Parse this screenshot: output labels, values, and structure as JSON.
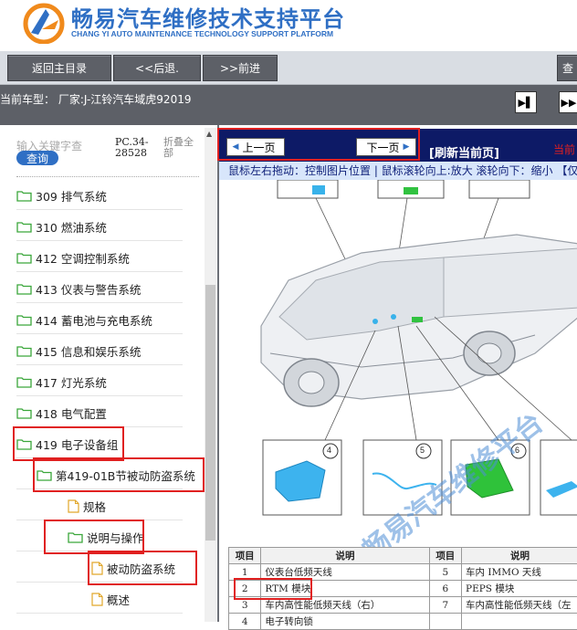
{
  "header": {
    "brand_cn": "畅易汽车维修技术支持平台",
    "brand_en": "CHANG YI AUTO MAINTENANCE TECHNOLOGY SUPPORT PLATFORM"
  },
  "toolbar": {
    "home_label": "返回主目录",
    "back_label": "<<后退.",
    "forward_label": ">>前进",
    "right_label": "查"
  },
  "vehicle": {
    "text": "当前车型： 厂家:J-江铃汽车域虎92019"
  },
  "search": {
    "placeholder": "输入关键字查",
    "button_label": "查询",
    "pc_label": "PC.34-28528",
    "collapse_label": "折叠全部"
  },
  "tree": [
    {
      "label": "309 排气系统"
    },
    {
      "label": "310 燃油系统"
    },
    {
      "label": "412 空调控制系统"
    },
    {
      "label": "413 仪表与警告系统"
    },
    {
      "label": "414 蓄电池与充电系统"
    },
    {
      "label": "415 信息和娱乐系统"
    },
    {
      "label": "417 灯光系统"
    },
    {
      "label": "418 电气配置"
    },
    {
      "label": "419 电子设备组"
    },
    {
      "label": "第419-01B节被动防盗系统"
    },
    {
      "label": "规格"
    },
    {
      "label": "说明与操作"
    },
    {
      "label": "被动防盗系统"
    },
    {
      "label": "概述"
    }
  ],
  "viewer": {
    "prev_label": "上一页",
    "next_label": "下一页",
    "refresh_label": "[刷新当前页]",
    "current_label": "当前",
    "hint": "鼠标左右拖动：控制图片位置 | 鼠标滚轮向上:放大  滚轮向下：缩小 【仅",
    "figure_id": "JMC35641901B001",
    "watermark": "畅易汽车维修平台",
    "callouts": [
      "4",
      "5",
      "6"
    ]
  },
  "table": {
    "headers": [
      "项目",
      "说明",
      "项目",
      "说明"
    ],
    "rows": [
      [
        "1",
        "仪表台低频天线",
        "5",
        "车内 IMMO 天线"
      ],
      [
        "2",
        "RTM 模块",
        "6",
        "PEPS 模块"
      ],
      [
        "3",
        "车内高性能低频天线（右）",
        "7",
        "车内高性能低频天线（左"
      ],
      [
        "4",
        "电子转向锁",
        "",
        ""
      ]
    ]
  },
  "colors": {
    "brand_blue": "#2f6fc4",
    "toolbar_button": "#5d6067",
    "viewer_bar": "#0d1a66",
    "highlight_red": "#e02020"
  }
}
